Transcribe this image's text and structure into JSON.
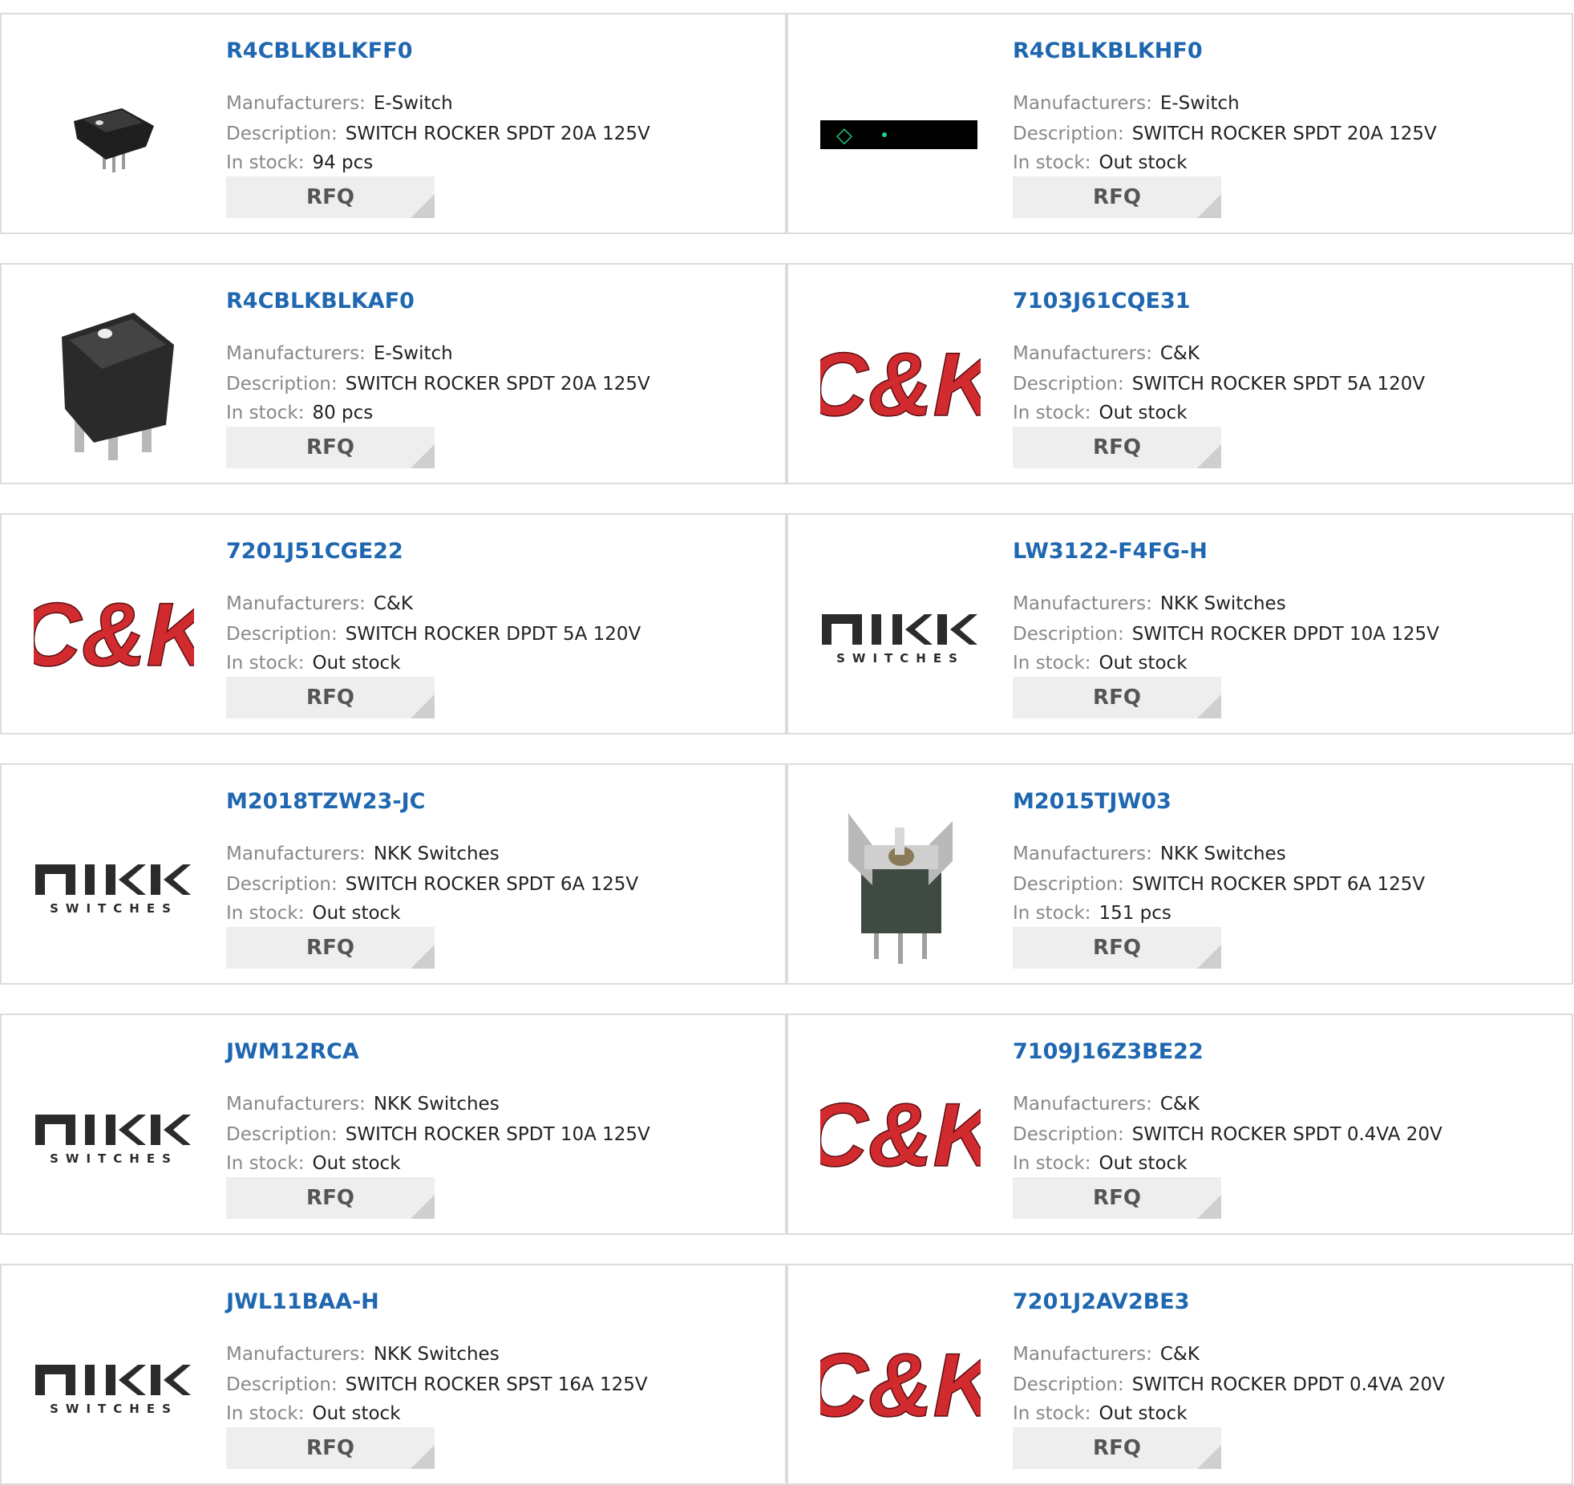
{
  "colors": {
    "part_link": "#1f67b0",
    "label": "#888888",
    "value": "#222222",
    "rfq_bg": "#eeeeee",
    "rfq_text": "#555555",
    "border": "#dcdcdc",
    "ck_red": "#d12b30"
  },
  "labels": {
    "manufacturers": "Manufacturers:",
    "description": "Description:",
    "in_stock": "In stock:",
    "rfq": "RFQ"
  },
  "logo_text": {
    "ck": "C&K",
    "nkk_main": "NKK",
    "nkk_sub": "SWITCHES"
  },
  "products": [
    {
      "part": "R4CBLKBLKFF0",
      "manufacturer": "E-Switch",
      "description": "SWITCH ROCKER SPDT 20A 125V",
      "stock": "94 pcs",
      "image": "rocker-small-icon"
    },
    {
      "part": "R4CBLKBLKHF0",
      "manufacturer": "E-Switch",
      "description": "SWITCH ROCKER SPDT 20A 125V",
      "stock": "Out stock",
      "image": "dark-strip-icon"
    },
    {
      "part": "R4CBLKBLKAF0",
      "manufacturer": "E-Switch",
      "description": "SWITCH ROCKER SPDT 20A 125V",
      "stock": "80 pcs",
      "image": "rocker-large-icon"
    },
    {
      "part": "7103J61CQE31",
      "manufacturer": "C&K",
      "description": "SWITCH ROCKER SPDT 5A 120V",
      "stock": "Out stock",
      "image": "ck-logo"
    },
    {
      "part": "7201J51CGE22",
      "manufacturer": "C&K",
      "description": "SWITCH ROCKER DPDT 5A 120V",
      "stock": "Out stock",
      "image": "ck-logo"
    },
    {
      "part": "LW3122-F4FG-H",
      "manufacturer": "NKK Switches",
      "description": "SWITCH ROCKER DPDT 10A 125V",
      "stock": "Out stock",
      "image": "nkk-logo"
    },
    {
      "part": "M2018TZW23-JC",
      "manufacturer": "NKK Switches",
      "description": "SWITCH ROCKER SPDT 6A 125V",
      "stock": "Out stock",
      "image": "nkk-logo"
    },
    {
      "part": "M2015TJW03",
      "manufacturer": "NKK Switches",
      "description": "SWITCH ROCKER SPDT 6A 125V",
      "stock": "151 pcs",
      "image": "toggle-guard-icon"
    },
    {
      "part": "JWM12RCA",
      "manufacturer": "NKK Switches",
      "description": "SWITCH ROCKER SPDT 10A 125V",
      "stock": "Out stock",
      "image": "nkk-logo"
    },
    {
      "part": "7109J16Z3BE22",
      "manufacturer": "C&K",
      "description": "SWITCH ROCKER SPDT 0.4VA 20V",
      "stock": "Out stock",
      "image": "ck-logo"
    },
    {
      "part": "JWL11BAA-H",
      "manufacturer": "NKK Switches",
      "description": "SWITCH ROCKER SPST 16A 125V",
      "stock": "Out stock",
      "image": "nkk-logo"
    },
    {
      "part": "7201J2AV2BE3",
      "manufacturer": "C&K",
      "description": "SWITCH ROCKER DPDT 0.4VA 20V",
      "stock": "Out stock",
      "image": "ck-logo"
    }
  ]
}
